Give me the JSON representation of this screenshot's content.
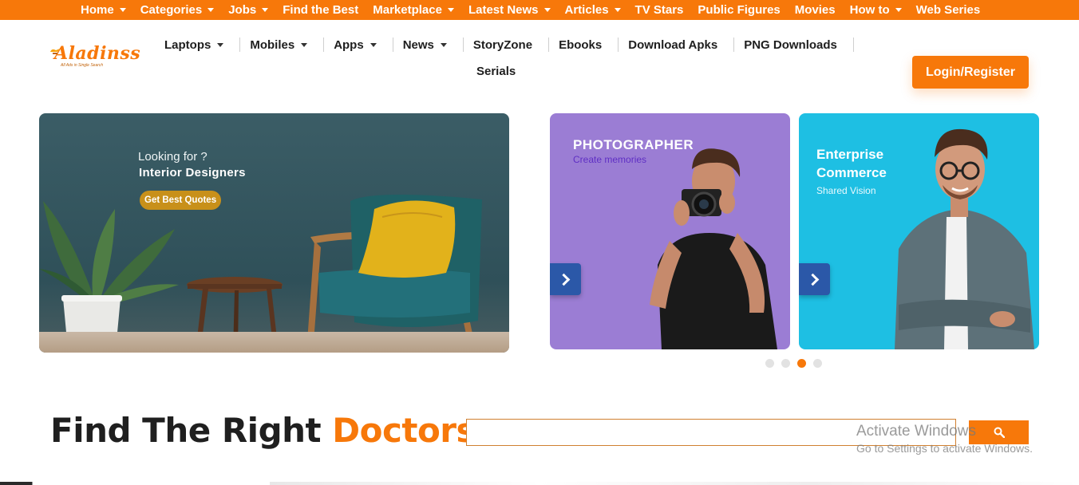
{
  "topbar": {
    "items": [
      {
        "label": "Home",
        "dropdown": true
      },
      {
        "label": "Categories",
        "dropdown": true
      },
      {
        "label": "Jobs",
        "dropdown": true
      },
      {
        "label": "Find the Best",
        "dropdown": false
      },
      {
        "label": "Marketplace",
        "dropdown": true
      },
      {
        "label": "Latest News",
        "dropdown": true
      },
      {
        "label": "Articles",
        "dropdown": true
      },
      {
        "label": "TV Stars",
        "dropdown": false
      },
      {
        "label": "Public Figures",
        "dropdown": false
      },
      {
        "label": "Movies",
        "dropdown": false
      },
      {
        "label": "How to",
        "dropdown": true
      },
      {
        "label": "Web Series",
        "dropdown": false
      }
    ]
  },
  "logo": {
    "name": "Aladinss",
    "tagline": "All Ads in Single Search"
  },
  "nav": {
    "items": [
      {
        "label": "Laptops",
        "dropdown": true
      },
      {
        "label": "Mobiles",
        "dropdown": true
      },
      {
        "label": "Apps",
        "dropdown": true
      },
      {
        "label": "News",
        "dropdown": true
      },
      {
        "label": "StoryZone",
        "dropdown": false
      },
      {
        "label": "Ebooks",
        "dropdown": false
      },
      {
        "label": "Download Apks",
        "dropdown": false
      },
      {
        "label": "PNG Downloads",
        "dropdown": false
      }
    ],
    "second_row": "Serials"
  },
  "login_label": "Login/Register",
  "hero": {
    "looking": "Looking for ?",
    "title": "Interior Designers",
    "button": "Get Best Quotes"
  },
  "cards": [
    {
      "title": "PHOTOGRAPHER",
      "subtitle": "Create memories"
    },
    {
      "title": "Enterprise Commerce",
      "subtitle": "Shared Vision"
    }
  ],
  "carousel": {
    "count": 4,
    "active_index": 2
  },
  "find": {
    "title_prefix": "Find The Right",
    "title_accent": "Doctors"
  },
  "search": {
    "placeholder": "",
    "value": ""
  },
  "watermark": {
    "line1": "Activate Windows",
    "line2": "Go to Settings to activate Windows."
  },
  "colors": {
    "accent": "#f7780a",
    "purple_card": "#9b7dd4",
    "cyan_card": "#1ebfe3",
    "arrow": "#2b58a8"
  },
  "icons": {
    "search": "search-icon",
    "next": "chevron-right-icon"
  }
}
